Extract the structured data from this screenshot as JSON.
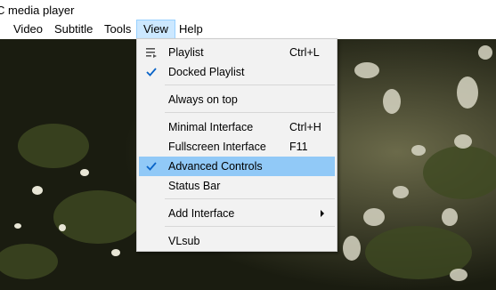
{
  "window": {
    "title": "C media player"
  },
  "menubar": {
    "items": [
      {
        "label": "Video"
      },
      {
        "label": "Subtitle"
      },
      {
        "label": "Tools"
      },
      {
        "label": "View"
      },
      {
        "label": "Help"
      }
    ],
    "active": "View"
  },
  "view_menu": {
    "items": [
      {
        "label": "Playlist",
        "shortcut": "Ctrl+L",
        "icon": "playlist-icon",
        "checked": false
      },
      {
        "label": "Docked Playlist",
        "shortcut": "",
        "checked": true
      },
      {
        "label": "Always on top",
        "shortcut": "",
        "checked": false
      },
      {
        "label": "Minimal Interface",
        "shortcut": "Ctrl+H",
        "checked": false
      },
      {
        "label": "Fullscreen Interface",
        "shortcut": "F11",
        "checked": false
      },
      {
        "label": "Advanced Controls",
        "shortcut": "",
        "checked": true,
        "highlighted": true
      },
      {
        "label": "Status Bar",
        "shortcut": "",
        "checked": false
      },
      {
        "label": "Add Interface",
        "shortcut": "",
        "submenu": true,
        "icon": "submenu-arrow-icon"
      },
      {
        "label": "VLsub",
        "shortcut": ""
      }
    ]
  },
  "colors": {
    "menu_bg": "#f2f2f2",
    "highlight": "#91c9f7",
    "active_menu_bg": "#cce8ff",
    "checkmark": "#0a64c8"
  }
}
